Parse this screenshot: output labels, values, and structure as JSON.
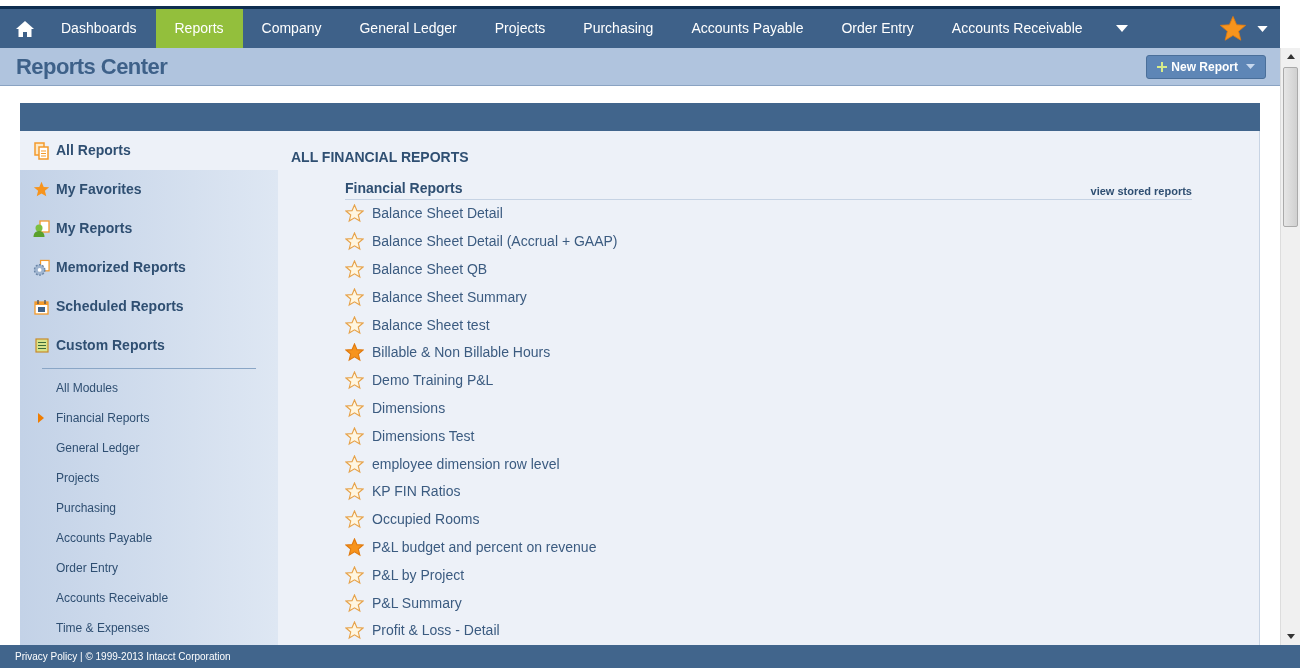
{
  "nav": {
    "tabs": [
      {
        "label": "Dashboards",
        "selected": false
      },
      {
        "label": "Reports",
        "selected": true
      },
      {
        "label": "Company",
        "selected": false
      },
      {
        "label": "General Ledger",
        "selected": false
      },
      {
        "label": "Projects",
        "selected": false
      },
      {
        "label": "Purchasing",
        "selected": false
      },
      {
        "label": "Accounts Payable",
        "selected": false
      },
      {
        "label": "Order Entry",
        "selected": false
      },
      {
        "label": "Accounts Receivable",
        "selected": false
      }
    ]
  },
  "header": {
    "title": "Reports Center",
    "new_button": "New Report"
  },
  "sidebar": {
    "categories": [
      {
        "label": "All Reports",
        "selected": true
      },
      {
        "label": "My Favorites",
        "selected": false
      },
      {
        "label": "My Reports",
        "selected": false
      },
      {
        "label": "Memorized Reports",
        "selected": false
      },
      {
        "label": "Scheduled Reports",
        "selected": false
      },
      {
        "label": "Custom Reports",
        "selected": false
      }
    ],
    "modules": [
      {
        "label": "All Modules",
        "selected": false
      },
      {
        "label": "Financial Reports",
        "selected": true
      },
      {
        "label": "General Ledger",
        "selected": false
      },
      {
        "label": "Projects",
        "selected": false
      },
      {
        "label": "Purchasing",
        "selected": false
      },
      {
        "label": "Accounts Payable",
        "selected": false
      },
      {
        "label": "Order Entry",
        "selected": false
      },
      {
        "label": "Accounts Receivable",
        "selected": false
      },
      {
        "label": "Time & Expenses",
        "selected": false
      }
    ]
  },
  "content": {
    "title": "ALL FINANCIAL REPORTS",
    "section": "Financial Reports",
    "link": "view stored reports",
    "reports": [
      {
        "label": "Balance Sheet Detail",
        "favorite": false
      },
      {
        "label": "Balance Sheet Detail (Accrual + GAAP)",
        "favorite": false
      },
      {
        "label": "Balance Sheet QB",
        "favorite": false
      },
      {
        "label": "Balance Sheet Summary",
        "favorite": false
      },
      {
        "label": "Balance Sheet test",
        "favorite": false
      },
      {
        "label": "Billable & Non Billable Hours",
        "favorite": true
      },
      {
        "label": "Demo Training P&L",
        "favorite": false
      },
      {
        "label": "Dimensions",
        "favorite": false
      },
      {
        "label": "Dimensions Test",
        "favorite": false
      },
      {
        "label": "employee dimension row level",
        "favorite": false
      },
      {
        "label": "KP FIN Ratios",
        "favorite": false
      },
      {
        "label": "Occupied Rooms",
        "favorite": false
      },
      {
        "label": "P&L budget and percent on revenue",
        "favorite": true
      },
      {
        "label": "P&L by Project",
        "favorite": false
      },
      {
        "label": "P&L Summary",
        "favorite": false
      },
      {
        "label": "Profit & Loss - Detail",
        "favorite": false
      }
    ]
  },
  "footer": "Privacy Policy | © 1999-2013  Intacct Corporation"
}
